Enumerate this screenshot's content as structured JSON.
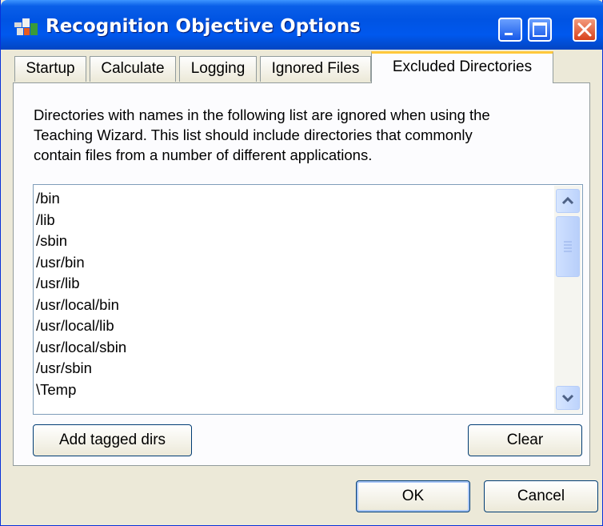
{
  "window": {
    "title": "Recognition Objective Options",
    "controls": {
      "minimize": "minimize-icon",
      "maximize": "maximize-icon",
      "close": "close-icon"
    }
  },
  "tabs": [
    {
      "label": "Startup",
      "active": false
    },
    {
      "label": "Calculate",
      "active": false
    },
    {
      "label": "Logging",
      "active": false
    },
    {
      "label": "Ignored Files",
      "active": false
    },
    {
      "label": "Excluded Directories",
      "active": true
    }
  ],
  "panel": {
    "description_lines": [
      "Directories with names in the following list are ignored when using the",
      "Teaching Wizard.  This list should include directories that commonly",
      "contain files from a number of different applications."
    ],
    "directories": [
      "/bin",
      "/lib",
      "/sbin",
      "/usr/bin",
      "/usr/lib",
      "/usr/local/bin",
      "/usr/local/lib",
      "/usr/local/sbin",
      "/usr/sbin",
      "\\Temp"
    ],
    "add_tagged_label": "Add tagged dirs",
    "clear_label": "Clear"
  },
  "footer": {
    "ok_label": "OK",
    "cancel_label": "Cancel"
  },
  "colors": {
    "title_bar": "#0054e3",
    "dialog_bg": "#ece9d8",
    "active_tab_accent": "#ffc83c",
    "close_button": "#d8421c"
  }
}
